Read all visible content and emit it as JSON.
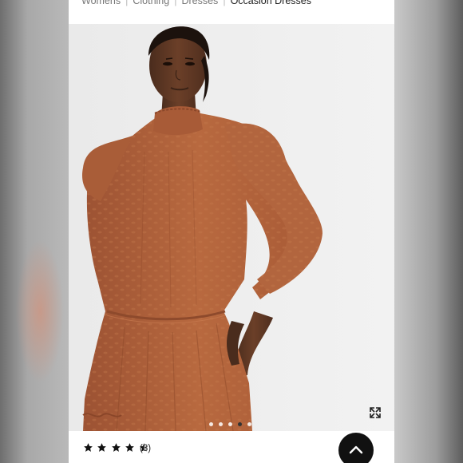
{
  "breadcrumb": {
    "items": [
      "Womens",
      "Clothing",
      "Dresses"
    ],
    "current": "Occasion Dresses"
  },
  "gallery": {
    "image_alt": "Model wearing rust high-neck jacquard midi dress",
    "dot_count": 5,
    "active_dot": 4,
    "expand_icon": "expand-icon"
  },
  "rating": {
    "stars": 4.5,
    "count_label": "(3)"
  },
  "colors": {
    "dress": "#b0613c",
    "background": "#ececec",
    "button": "#111111"
  },
  "scroll_top_icon": "chevron-up-icon"
}
